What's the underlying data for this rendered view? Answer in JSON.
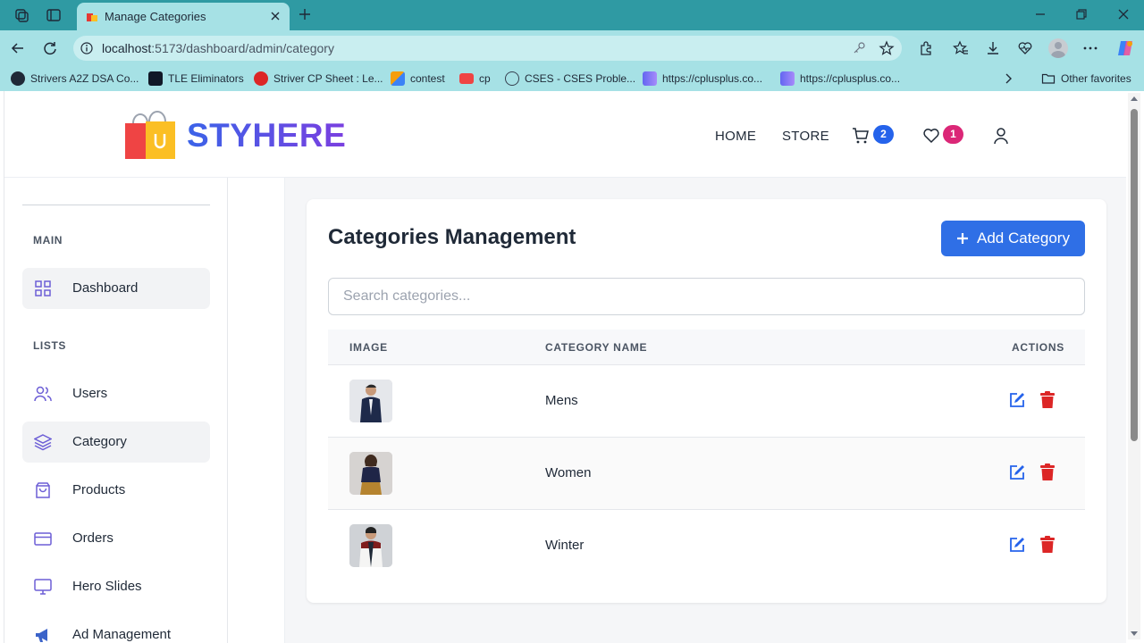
{
  "browser": {
    "tab_title": "Manage Categories",
    "url_host": "localhost",
    "url_path": ":5173/dashboard/admin/category",
    "favorites": [
      {
        "label": "Strivers A2Z DSA Co...",
        "icon_color": "#1f2937"
      },
      {
        "label": "TLE Eliminators",
        "icon_color": "#111827"
      },
      {
        "label": "Striver CP Sheet : Le...",
        "icon_color": "#dc2626"
      },
      {
        "label": "contest",
        "icon_color": "#f59e0b"
      },
      {
        "label": "cp",
        "icon_color": "#ef4444"
      },
      {
        "label": "CSES - CSES Proble...",
        "icon_color": "#374151"
      },
      {
        "label": "https://cplusplus.co...",
        "icon_color": "#6366f1"
      },
      {
        "label": "https://cplusplus.co...",
        "icon_color": "#6366f1"
      }
    ],
    "other_favorites": "Other favorites"
  },
  "header": {
    "brand": "STYHERE",
    "nav": {
      "home": "HOME",
      "store": "STORE"
    },
    "cart_count": "2",
    "wishlist_count": "1"
  },
  "sidebar": {
    "sections": [
      {
        "heading": "MAIN",
        "items": [
          {
            "label": "Dashboard",
            "icon": "grid-icon",
            "active": true
          }
        ]
      },
      {
        "heading": "LISTS",
        "items": [
          {
            "label": "Users",
            "icon": "users-icon",
            "active": false
          },
          {
            "label": "Category",
            "icon": "layers-icon",
            "active": true
          },
          {
            "label": "Products",
            "icon": "shopping-bag-icon",
            "active": false
          },
          {
            "label": "Orders",
            "icon": "credit-card-icon",
            "active": false
          },
          {
            "label": "Hero Slides",
            "icon": "monitor-icon",
            "active": false
          },
          {
            "label": "Ad Management",
            "icon": "megaphone-icon",
            "active": false
          }
        ]
      }
    ]
  },
  "main": {
    "title": "Categories Management",
    "add_button": "Add Category",
    "search_placeholder": "Search categories...",
    "columns": [
      "IMAGE",
      "CATEGORY NAME",
      "ACTIONS"
    ],
    "rows": [
      {
        "name": "Mens"
      },
      {
        "name": "Women"
      },
      {
        "name": "Winter"
      }
    ]
  },
  "colors": {
    "accent": "#2f6fe6",
    "brand": "#3b55e6",
    "sidebar_icon": "#6d5fd6",
    "badge_cart": "#2563eb",
    "badge_wishlist": "#db2777",
    "edit": "#2563eb",
    "delete": "#dc2626",
    "browser_chrome": "#a6e1e5"
  }
}
